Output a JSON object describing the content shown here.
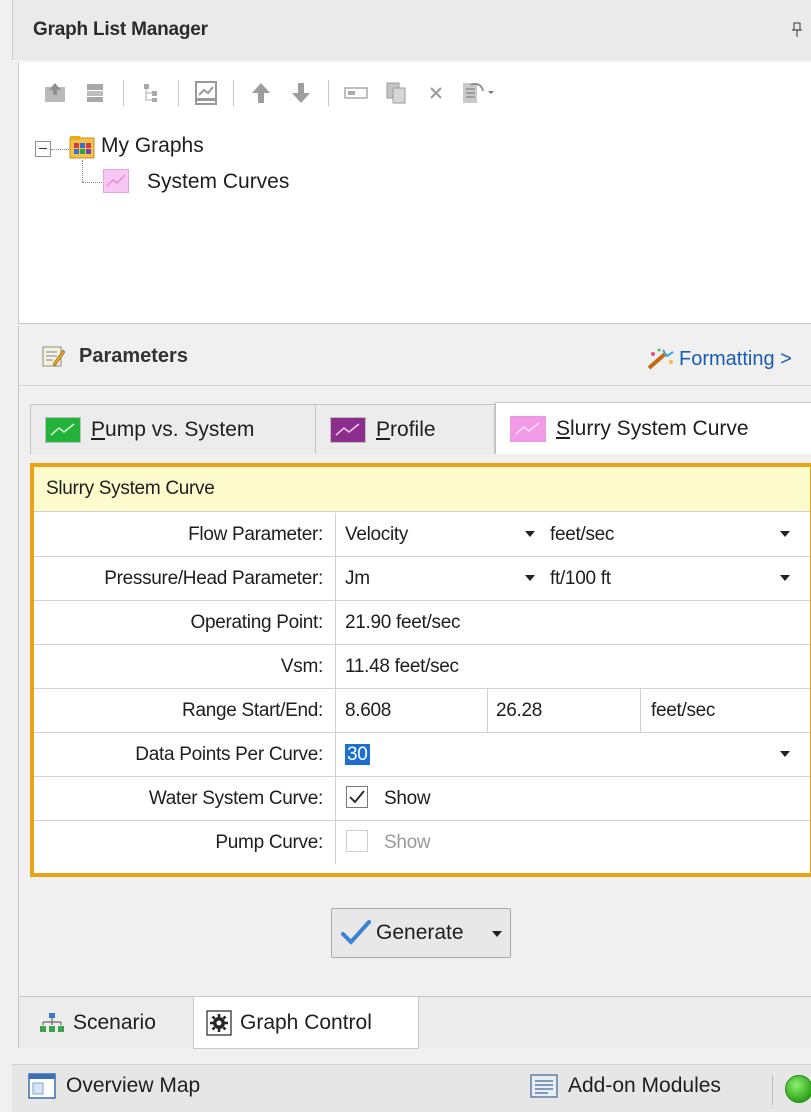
{
  "graph_list_manager": {
    "title": "Graph List Manager",
    "toolbar_icons": [
      "add-graph-icon",
      "add-folder-icon",
      "tree-icon",
      "save-graph-icon",
      "move-up-icon",
      "move-down-icon",
      "rename-icon",
      "copy-icon",
      "delete-icon",
      "options-icon"
    ],
    "tree": {
      "root_label": "My Graphs",
      "children": [
        {
          "label": "System Curves"
        }
      ]
    }
  },
  "parameters": {
    "title": "Parameters",
    "formatting_link": "Formatting >",
    "tabs": [
      {
        "mnemonic": "P",
        "rest": "ump vs. System",
        "icon_color": "#22b33a"
      },
      {
        "mnemonic": "P",
        "rest": "rofile",
        "icon_color": "#8c2f8c"
      },
      {
        "mnemonic": "S",
        "rest": "lurry System Curve",
        "icon_color": "#f29ae8",
        "selected": true
      }
    ],
    "table": {
      "caption": "Slurry System Curve",
      "rows": [
        {
          "label": "Flow Parameter:",
          "value": "Velocity",
          "unit": "feet/sec"
        },
        {
          "label": "Pressure/Head Parameter:",
          "value": "Jm",
          "unit": "ft/100 ft"
        },
        {
          "label": "Operating Point:",
          "value": "21.90 feet/sec"
        },
        {
          "label": "Vsm:",
          "value": "11.48 feet/sec"
        },
        {
          "label": "Range Start/End:",
          "start": "8.608",
          "end": "26.28",
          "unit": "feet/sec"
        },
        {
          "label": "Data Points Per Curve:",
          "value": "30"
        },
        {
          "label": "Water System Curve:",
          "check_label": "Show",
          "checked": true
        },
        {
          "label": "Pump Curve:",
          "check_label": "Show",
          "checked": false,
          "disabled": true
        }
      ]
    },
    "generate_button": "Generate",
    "accent_color": "#e8a317"
  },
  "bottom_tabs": {
    "scenario": "Scenario",
    "graph_control": "Graph Control"
  },
  "status_bar": {
    "overview_map": "Overview Map",
    "addon_modules": "Add-on Modules",
    "status_color": "#3cb526"
  }
}
